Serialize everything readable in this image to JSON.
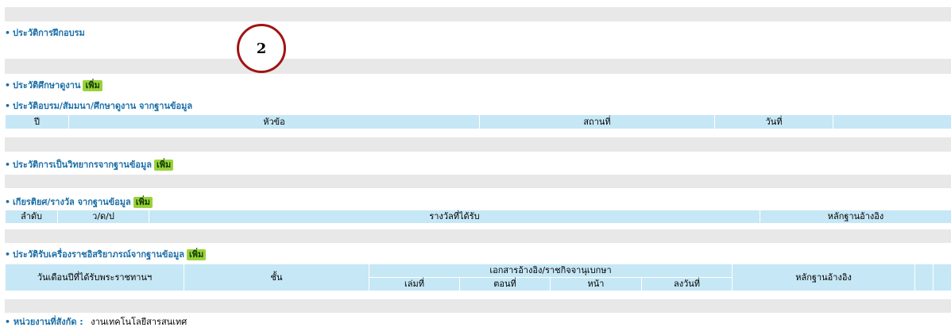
{
  "add_label": "เพิ่ม",
  "bullet": "•",
  "sections": {
    "training": {
      "title": "ประวัติการฝึกอบรม"
    },
    "study_visit": {
      "title": "ประวัติศึกษาดูงาน"
    },
    "seminar": {
      "title": "ประวัติอบรม/สัมมนา/ศึกษาดูงาน จากฐานข้อมูล",
      "columns": [
        "ปี",
        "หัวข้อ",
        "สถานที่",
        "วันที่",
        ""
      ]
    },
    "speaker": {
      "title": "ประวัติการเป็นวิทยากรจากฐานข้อมูล"
    },
    "award": {
      "title": "เกียรติยศ/รางวัล จากฐานข้อมูล",
      "columns": [
        "ลำดับ",
        "ว/ด/ป",
        "รางวัลที่ได้รับ",
        "หลักฐานอ้างอิง"
      ]
    },
    "decoration": {
      "title": "ประวัติรับเครื่องราชอิสริยาภรณ์จากฐานข้อมูล",
      "columns": {
        "date": "วันเดือนปีที่ได้รับพระราชทานฯ",
        "class": "ชั้น",
        "gazette": "เอกสารอ้างอิง/ราชกิจจานุเบกษา",
        "volume": "เล่มที่",
        "section": "ตอนที่",
        "page": "หน้า",
        "dated": "ลงวันที่",
        "evidence": "หลักฐานอ้างอิง"
      }
    }
  },
  "unit": {
    "label": "หน่วยงานที่สังกัด :",
    "value": "งานเทคโนโลยีสารสนเทศ"
  },
  "annotation": {
    "number": "2"
  },
  "colors": {
    "title": "#1b6fa8",
    "header_bg": "#c6e7f5",
    "add_bg": "#9ad13c",
    "gray_band": "#e8e8e8",
    "circle": "#a01414"
  }
}
